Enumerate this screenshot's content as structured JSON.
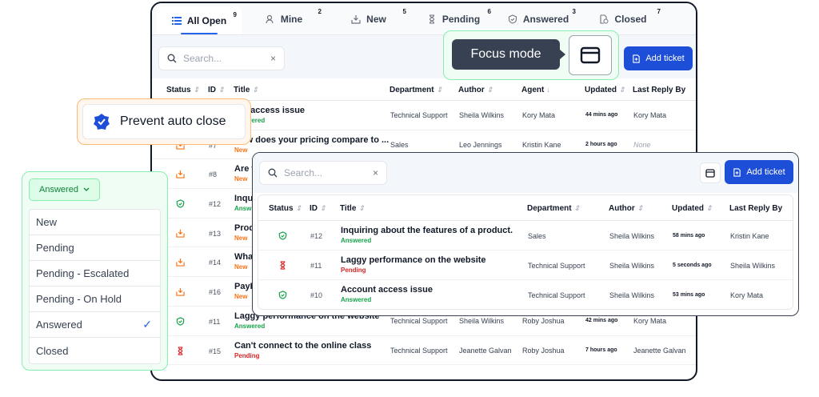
{
  "main": {
    "tabs": [
      {
        "label": "All Open",
        "count": "9",
        "icon": "list-icon"
      },
      {
        "label": "Mine",
        "count": "2",
        "icon": "user-icon"
      },
      {
        "label": "New",
        "count": "5",
        "icon": "inbox-icon"
      },
      {
        "label": "Pending",
        "count": "6",
        "icon": "hourglass-icon"
      },
      {
        "label": "Answered",
        "count": "3",
        "icon": "shield-check-icon"
      },
      {
        "label": "Closed",
        "count": "7",
        "icon": "doc-clock-icon"
      }
    ],
    "search": {
      "placeholder": "Search...",
      "clear": "×"
    },
    "add_ticket": "Add ticket",
    "columns": {
      "status": "Status",
      "id": "ID",
      "title": "Title",
      "department": "Department",
      "author": "Author",
      "agent": "Agent",
      "updated": "Updated",
      "last_reply": "Last Reply By"
    },
    "rows": [
      {
        "status": "answered",
        "id": "",
        "title": "unt access issue",
        "label": "Answered",
        "department": "Technical Support",
        "author": "Sheila Wilkins",
        "agent": "Kory Mata",
        "updated": "44 mins ago",
        "last_reply": "Kory Mata"
      },
      {
        "status": "new",
        "id": "#7",
        "title": "How does your pricing compare to ...",
        "label": "New",
        "department": "Sales",
        "author": "Leo Jennings",
        "agent": "Kristin Kane",
        "updated": "2 hours ago",
        "last_reply": "None"
      },
      {
        "status": "new",
        "id": "#8",
        "title": "Are t",
        "label": "New",
        "department": "",
        "author": "",
        "agent": "",
        "updated": "",
        "last_reply": ""
      },
      {
        "status": "answered",
        "id": "#12",
        "title": "Inqu",
        "label": "Answ",
        "department": "",
        "author": "",
        "agent": "",
        "updated": "",
        "last_reply": ""
      },
      {
        "status": "new",
        "id": "#13",
        "title": "Prod",
        "label": "New",
        "department": "",
        "author": "",
        "agent": "",
        "updated": "",
        "last_reply": ""
      },
      {
        "status": "new",
        "id": "#14",
        "title": "What",
        "label": "New",
        "department": "",
        "author": "",
        "agent": "",
        "updated": "",
        "last_reply": ""
      },
      {
        "status": "new",
        "id": "#16",
        "title": "PayP",
        "label": "New",
        "department": "",
        "author": "",
        "agent": "",
        "updated": "",
        "last_reply": ""
      },
      {
        "status": "answered",
        "id": "#11",
        "title": "Laggy performance on the website",
        "label": "Answered",
        "department": "Technical Support",
        "author": "Sheila Wilkins",
        "agent": "Roby Joshua",
        "updated": "42 mins ago",
        "last_reply": "Kory Mata"
      },
      {
        "status": "pending",
        "id": "#15",
        "title": "Can't connect to the online class",
        "label": "Pending",
        "department": "Technical Support",
        "author": "Jeanette Galvan",
        "agent": "Roby Joshua",
        "updated": "7 hours ago",
        "last_reply": "Jeanette Galvan"
      }
    ]
  },
  "prevent": {
    "label": "Prevent auto close"
  },
  "focus": {
    "tooltip": "Focus mode"
  },
  "dropdown": {
    "selected": "Answered",
    "options": [
      "New",
      "Pending",
      "Pending - Escalated",
      "Pending - On Hold",
      "Answered",
      "Closed"
    ],
    "checked_index": 4
  },
  "front": {
    "search": {
      "placeholder": "Search...",
      "clear": "×"
    },
    "add_ticket": "Add ticket",
    "columns": {
      "status": "Status",
      "id": "ID",
      "title": "Title",
      "department": "Department",
      "author": "Author",
      "updated": "Updated",
      "last_reply": "Last Reply By"
    },
    "rows": [
      {
        "status": "answered",
        "id": "#12",
        "title": "Inquiring about the features of a product.",
        "label": "Answered",
        "department": "Sales",
        "author": "Sheila Wilkins",
        "updated": "58 mins ago",
        "last_reply": "Kristin Kane"
      },
      {
        "status": "pending",
        "id": "#11",
        "title": "Laggy performance on the website",
        "label": "Pending",
        "department": "Technical Support",
        "author": "Sheila Wilkins",
        "updated": "5 seconds ago",
        "last_reply": "Sheila Wilkins"
      },
      {
        "status": "answered",
        "id": "#10",
        "title": "Account access issue",
        "label": "Answered",
        "department": "Technical Support",
        "author": "Sheila Wilkins",
        "updated": "53 mins ago",
        "last_reply": "Kory Mata"
      }
    ]
  },
  "colors": {
    "accent": "#1d4ed8",
    "answered": "#16a34a",
    "new": "#f97316",
    "pending": "#dc2626"
  }
}
